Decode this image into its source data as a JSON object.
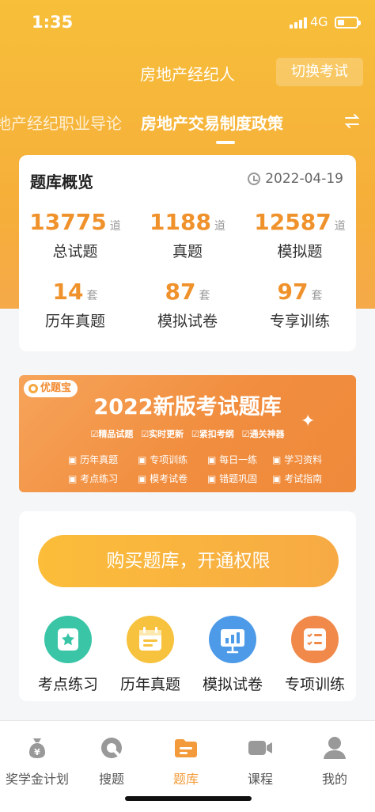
{
  "status_bar": {
    "time": "1:35",
    "network": "4G"
  },
  "header": {
    "title": "房地产经纪人",
    "switch_label": "切换考试"
  },
  "subjects": {
    "prev": "地产经纪职业导论",
    "active": "房地产交易制度政策",
    "swap_icon": "swap-arrows-icon"
  },
  "overview": {
    "title": "题库概览",
    "date": "2022-04-19",
    "stats": [
      {
        "value": "13775",
        "unit": "道",
        "label": "总试题"
      },
      {
        "value": "1188",
        "unit": "道",
        "label": "真题"
      },
      {
        "value": "12587",
        "unit": "道",
        "label": "模拟题"
      },
      {
        "value": "14",
        "unit": "套",
        "label": "历年真题"
      },
      {
        "value": "87",
        "unit": "套",
        "label": "模拟试卷"
      },
      {
        "value": "97",
        "unit": "套",
        "label": "专享训练"
      }
    ]
  },
  "banner": {
    "logo": "优题宝",
    "headline": "2022新版考试题库",
    "tags": [
      "☑精品试题",
      "☑实时更新",
      "☑紧扣考纲",
      "☑通关神器"
    ],
    "features": [
      "历年真题",
      "专项训练",
      "每日一练",
      "学习资料",
      "考点练习",
      "模考试卷",
      "错题巩固",
      "考试指南"
    ]
  },
  "actions": {
    "buy_label": "购买题库，开通权限",
    "tools": [
      {
        "label": "考点练习",
        "icon": "star-card-icon",
        "color": "#39c5a6"
      },
      {
        "label": "历年真题",
        "icon": "calendar-icon",
        "color": "#f7c23d"
      },
      {
        "label": "模拟试卷",
        "icon": "chart-board-icon",
        "color": "#4c9ae8"
      },
      {
        "label": "专项训练",
        "icon": "checklist-icon",
        "color": "#f0894a"
      }
    ]
  },
  "tabbar": {
    "tabs": [
      {
        "label": "奖学金计划",
        "icon": "money-bag-icon"
      },
      {
        "label": "搜题",
        "icon": "search-icon"
      },
      {
        "label": "题库",
        "icon": "question-bank-icon",
        "active": true
      },
      {
        "label": "课程",
        "icon": "video-camera-icon"
      },
      {
        "label": "我的",
        "icon": "person-icon"
      }
    ]
  },
  "colors": {
    "accent": "#f39b3a",
    "hero": "#f7bf3a",
    "number": "#f0922c"
  }
}
